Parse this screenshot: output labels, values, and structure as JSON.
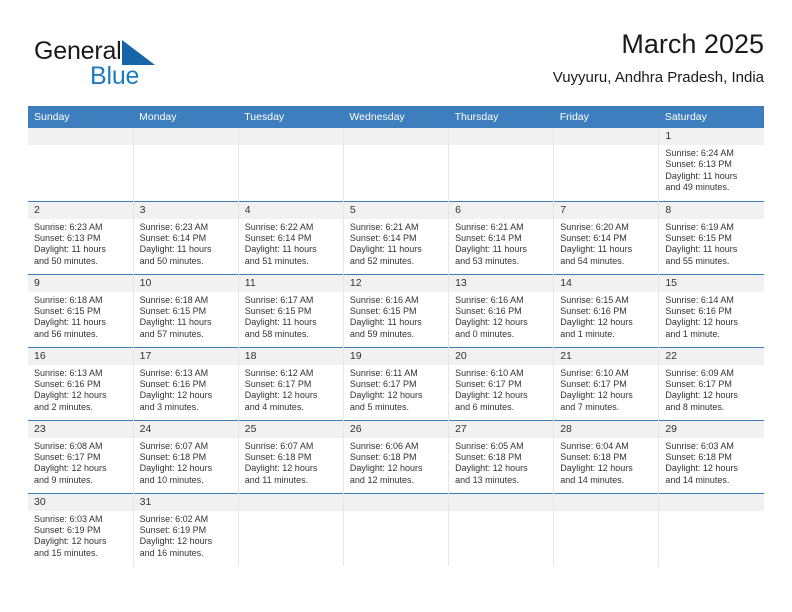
{
  "brand": {
    "name_part1": "General",
    "name_part2": "Blue",
    "logo_icon": "blue-flag-triangle",
    "color_dark": "#1a1a1a",
    "color_blue": "#1f7ac0"
  },
  "header": {
    "title": "March 2025",
    "subtitle": "Vuyyuru, Andhra Pradesh, India"
  },
  "theme": {
    "header_bg": "#3d7ebf",
    "daynum_bg": "#f1f1f1",
    "text": "#333333",
    "row_rule": "#3d7ebf"
  },
  "weekdays": [
    "Sunday",
    "Monday",
    "Tuesday",
    "Wednesday",
    "Thursday",
    "Friday",
    "Saturday"
  ],
  "labels": {
    "sunrise_prefix": "Sunrise:",
    "sunset_prefix": "Sunset:",
    "daylight_prefix": "Daylight:"
  },
  "weeks": [
    [
      {
        "day": "",
        "empty": true
      },
      {
        "day": "",
        "empty": true
      },
      {
        "day": "",
        "empty": true
      },
      {
        "day": "",
        "empty": true
      },
      {
        "day": "",
        "empty": true
      },
      {
        "day": "",
        "empty": true
      },
      {
        "day": "1",
        "sunrise": "Sunrise: 6:24 AM",
        "sunset": "Sunset: 6:13 PM",
        "daylight1": "Daylight: 11 hours",
        "daylight2": "and 49 minutes."
      }
    ],
    [
      {
        "day": "2",
        "sunrise": "Sunrise: 6:23 AM",
        "sunset": "Sunset: 6:13 PM",
        "daylight1": "Daylight: 11 hours",
        "daylight2": "and 50 minutes."
      },
      {
        "day": "3",
        "sunrise": "Sunrise: 6:23 AM",
        "sunset": "Sunset: 6:14 PM",
        "daylight1": "Daylight: 11 hours",
        "daylight2": "and 50 minutes."
      },
      {
        "day": "4",
        "sunrise": "Sunrise: 6:22 AM",
        "sunset": "Sunset: 6:14 PM",
        "daylight1": "Daylight: 11 hours",
        "daylight2": "and 51 minutes."
      },
      {
        "day": "5",
        "sunrise": "Sunrise: 6:21 AM",
        "sunset": "Sunset: 6:14 PM",
        "daylight1": "Daylight: 11 hours",
        "daylight2": "and 52 minutes."
      },
      {
        "day": "6",
        "sunrise": "Sunrise: 6:21 AM",
        "sunset": "Sunset: 6:14 PM",
        "daylight1": "Daylight: 11 hours",
        "daylight2": "and 53 minutes."
      },
      {
        "day": "7",
        "sunrise": "Sunrise: 6:20 AM",
        "sunset": "Sunset: 6:14 PM",
        "daylight1": "Daylight: 11 hours",
        "daylight2": "and 54 minutes."
      },
      {
        "day": "8",
        "sunrise": "Sunrise: 6:19 AM",
        "sunset": "Sunset: 6:15 PM",
        "daylight1": "Daylight: 11 hours",
        "daylight2": "and 55 minutes."
      }
    ],
    [
      {
        "day": "9",
        "sunrise": "Sunrise: 6:18 AM",
        "sunset": "Sunset: 6:15 PM",
        "daylight1": "Daylight: 11 hours",
        "daylight2": "and 56 minutes."
      },
      {
        "day": "10",
        "sunrise": "Sunrise: 6:18 AM",
        "sunset": "Sunset: 6:15 PM",
        "daylight1": "Daylight: 11 hours",
        "daylight2": "and 57 minutes."
      },
      {
        "day": "11",
        "sunrise": "Sunrise: 6:17 AM",
        "sunset": "Sunset: 6:15 PM",
        "daylight1": "Daylight: 11 hours",
        "daylight2": "and 58 minutes."
      },
      {
        "day": "12",
        "sunrise": "Sunrise: 6:16 AM",
        "sunset": "Sunset: 6:15 PM",
        "daylight1": "Daylight: 11 hours",
        "daylight2": "and 59 minutes."
      },
      {
        "day": "13",
        "sunrise": "Sunrise: 6:16 AM",
        "sunset": "Sunset: 6:16 PM",
        "daylight1": "Daylight: 12 hours",
        "daylight2": "and 0 minutes."
      },
      {
        "day": "14",
        "sunrise": "Sunrise: 6:15 AM",
        "sunset": "Sunset: 6:16 PM",
        "daylight1": "Daylight: 12 hours",
        "daylight2": "and 1 minute."
      },
      {
        "day": "15",
        "sunrise": "Sunrise: 6:14 AM",
        "sunset": "Sunset: 6:16 PM",
        "daylight1": "Daylight: 12 hours",
        "daylight2": "and 1 minute."
      }
    ],
    [
      {
        "day": "16",
        "sunrise": "Sunrise: 6:13 AM",
        "sunset": "Sunset: 6:16 PM",
        "daylight1": "Daylight: 12 hours",
        "daylight2": "and 2 minutes."
      },
      {
        "day": "17",
        "sunrise": "Sunrise: 6:13 AM",
        "sunset": "Sunset: 6:16 PM",
        "daylight1": "Daylight: 12 hours",
        "daylight2": "and 3 minutes."
      },
      {
        "day": "18",
        "sunrise": "Sunrise: 6:12 AM",
        "sunset": "Sunset: 6:17 PM",
        "daylight1": "Daylight: 12 hours",
        "daylight2": "and 4 minutes."
      },
      {
        "day": "19",
        "sunrise": "Sunrise: 6:11 AM",
        "sunset": "Sunset: 6:17 PM",
        "daylight1": "Daylight: 12 hours",
        "daylight2": "and 5 minutes."
      },
      {
        "day": "20",
        "sunrise": "Sunrise: 6:10 AM",
        "sunset": "Sunset: 6:17 PM",
        "daylight1": "Daylight: 12 hours",
        "daylight2": "and 6 minutes."
      },
      {
        "day": "21",
        "sunrise": "Sunrise: 6:10 AM",
        "sunset": "Sunset: 6:17 PM",
        "daylight1": "Daylight: 12 hours",
        "daylight2": "and 7 minutes."
      },
      {
        "day": "22",
        "sunrise": "Sunrise: 6:09 AM",
        "sunset": "Sunset: 6:17 PM",
        "daylight1": "Daylight: 12 hours",
        "daylight2": "and 8 minutes."
      }
    ],
    [
      {
        "day": "23",
        "sunrise": "Sunrise: 6:08 AM",
        "sunset": "Sunset: 6:17 PM",
        "daylight1": "Daylight: 12 hours",
        "daylight2": "and 9 minutes."
      },
      {
        "day": "24",
        "sunrise": "Sunrise: 6:07 AM",
        "sunset": "Sunset: 6:18 PM",
        "daylight1": "Daylight: 12 hours",
        "daylight2": "and 10 minutes."
      },
      {
        "day": "25",
        "sunrise": "Sunrise: 6:07 AM",
        "sunset": "Sunset: 6:18 PM",
        "daylight1": "Daylight: 12 hours",
        "daylight2": "and 11 minutes."
      },
      {
        "day": "26",
        "sunrise": "Sunrise: 6:06 AM",
        "sunset": "Sunset: 6:18 PM",
        "daylight1": "Daylight: 12 hours",
        "daylight2": "and 12 minutes."
      },
      {
        "day": "27",
        "sunrise": "Sunrise: 6:05 AM",
        "sunset": "Sunset: 6:18 PM",
        "daylight1": "Daylight: 12 hours",
        "daylight2": "and 13 minutes."
      },
      {
        "day": "28",
        "sunrise": "Sunrise: 6:04 AM",
        "sunset": "Sunset: 6:18 PM",
        "daylight1": "Daylight: 12 hours",
        "daylight2": "and 14 minutes."
      },
      {
        "day": "29",
        "sunrise": "Sunrise: 6:03 AM",
        "sunset": "Sunset: 6:18 PM",
        "daylight1": "Daylight: 12 hours",
        "daylight2": "and 14 minutes."
      }
    ],
    [
      {
        "day": "30",
        "sunrise": "Sunrise: 6:03 AM",
        "sunset": "Sunset: 6:19 PM",
        "daylight1": "Daylight: 12 hours",
        "daylight2": "and 15 minutes."
      },
      {
        "day": "31",
        "sunrise": "Sunrise: 6:02 AM",
        "sunset": "Sunset: 6:19 PM",
        "daylight1": "Daylight: 12 hours",
        "daylight2": "and 16 minutes."
      },
      {
        "day": "",
        "empty": true
      },
      {
        "day": "",
        "empty": true
      },
      {
        "day": "",
        "empty": true
      },
      {
        "day": "",
        "empty": true
      },
      {
        "day": "",
        "empty": true
      }
    ]
  ]
}
